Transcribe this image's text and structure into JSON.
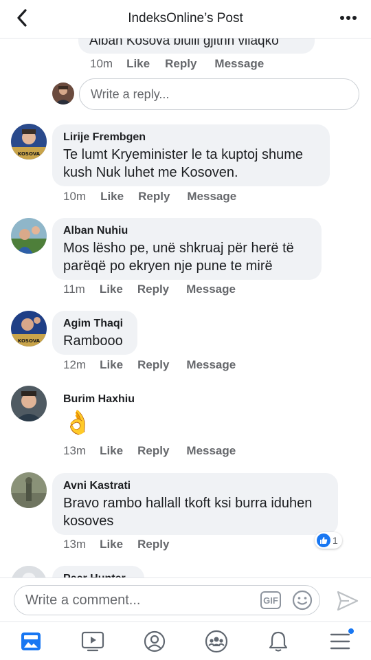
{
  "header": {
    "title": "IndeksOnline’s Post"
  },
  "top_partial": {
    "text": "Alban Kosova bluili gjithh viiaqko",
    "actions": {
      "time": "10m",
      "like": "Like",
      "reply": "Reply",
      "message": "Message"
    }
  },
  "reply_input": {
    "placeholder": "Write a reply..."
  },
  "comments": [
    {
      "author": "Lirije Frembgen",
      "text": "Te lumt Kryeminister le ta kuptoj shume kush Nuk luhet me Kosoven.",
      "time": "10m",
      "like": "Like",
      "reply": "Reply",
      "message": "Message"
    },
    {
      "author": "Alban Nuhiu",
      "text": "Mos lësho pe, unë shkruaj  për herë të parëqë po  ekryen nje pune te mirë",
      "time": "11m",
      "like": "Like",
      "reply": "Reply",
      "message": "Message"
    },
    {
      "author": "Agim Thaqi",
      "text": "Rambooo",
      "time": "12m",
      "like": "Like",
      "reply": "Reply",
      "message": "Message"
    },
    {
      "author": "Burim Haxhiu",
      "text": "👌",
      "time": "13m",
      "like": "Like",
      "reply": "Reply",
      "message": "Message"
    },
    {
      "author": "Avni Kastrati",
      "text": "Bravo rambo hallall tkoft ksi burra iduhen kosoves",
      "time": "13m",
      "like": "Like",
      "reply": "Reply",
      "reaction_count": "1"
    },
    {
      "author": "Peer Hunter"
    }
  ],
  "comment_bar": {
    "placeholder": "Write a comment...",
    "gif_label": "GIF"
  },
  "tabs": [
    "news-feed",
    "watch",
    "profile",
    "groups",
    "notifications",
    "menu"
  ],
  "colors": {
    "accent": "#1877f2",
    "bubble": "#f0f2f5",
    "muted": "#65676b"
  }
}
